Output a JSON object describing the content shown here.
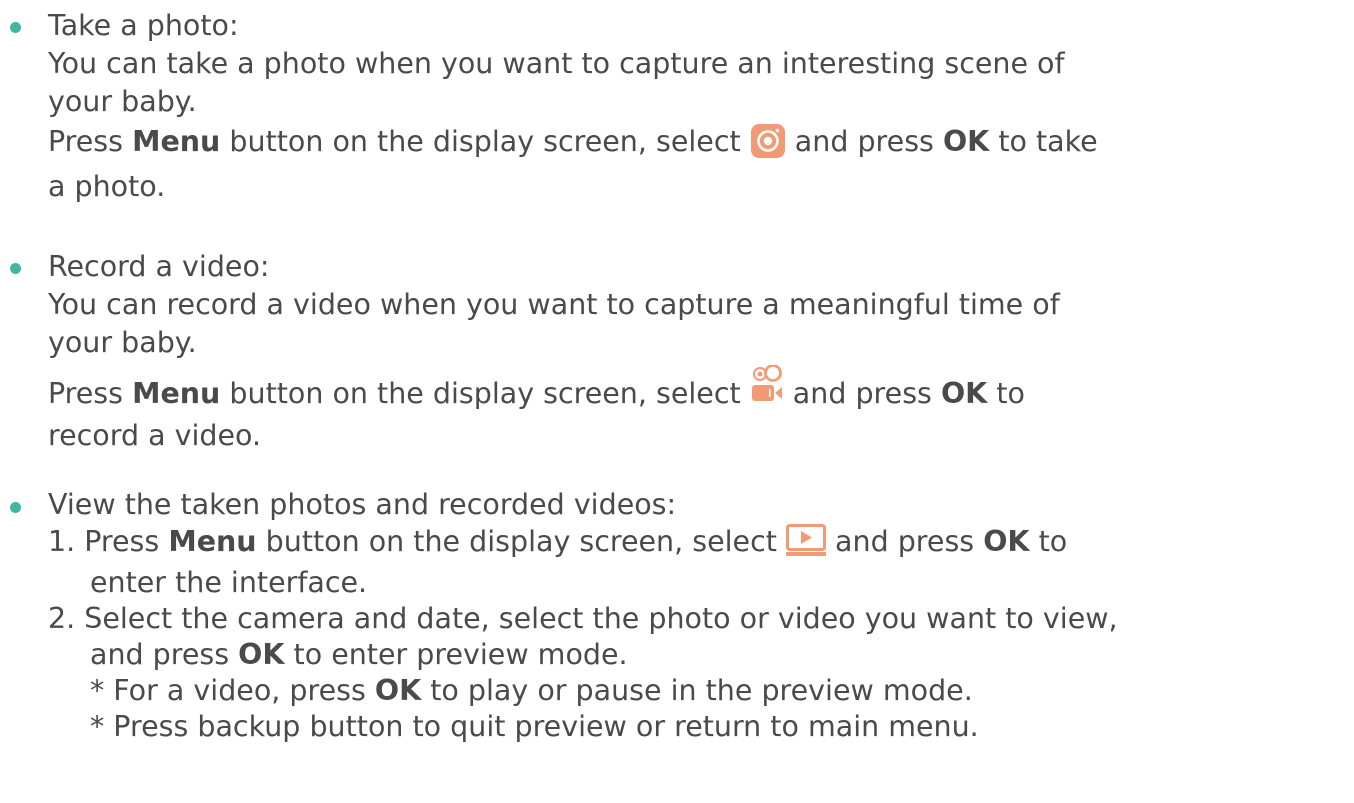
{
  "take_photo": {
    "heading": "Take a photo:",
    "desc_line1": "You can take a photo when you want to capture an interesting scene of",
    "desc_line2": "your baby.",
    "instr_pre": "Press ",
    "instr_bold1": "Menu",
    "instr_mid": " button on the display screen, select ",
    "instr_post": " and press ",
    "instr_bold2": "OK",
    "instr_end": " to take",
    "instr_line2": "a photo."
  },
  "record_video": {
    "heading": "Record a video:",
    "desc_line1": "You can record a video when you want to capture a meaningful time of",
    "desc_line2": "your baby.",
    "instr_pre": "Press ",
    "instr_bold1": "Menu",
    "instr_mid": " button on the display screen, select ",
    "instr_post": " and press ",
    "instr_bold2": "OK",
    "instr_end": " to",
    "instr_line2": "record a video."
  },
  "view_media": {
    "heading": "View the taken photos and recorded videos:",
    "step1_pre": "1. Press ",
    "step1_bold1": "Menu",
    "step1_mid": " button on the display screen, select ",
    "step1_post": " and press ",
    "step1_bold2": "OK",
    "step1_end": " to",
    "step1_line2": "enter the interface.",
    "step2_line1": "2. Select the camera and date, select the photo or video you want to view,",
    "step2_pre": "and press ",
    "step2_bold": "OK",
    "step2_end": " to enter preview mode.",
    "note1_pre": "* For a video, press ",
    "note1_bold": "OK",
    "note1_end": " to play or pause in the preview mode.",
    "note2": "* Press backup button to quit preview or return to main menu."
  },
  "colors": {
    "bullet": "#3fb8a0",
    "icon": "#f29a76",
    "text": "#4a4a4a"
  },
  "icons": [
    "camera-icon",
    "video-camera-icon",
    "playback-icon"
  ]
}
